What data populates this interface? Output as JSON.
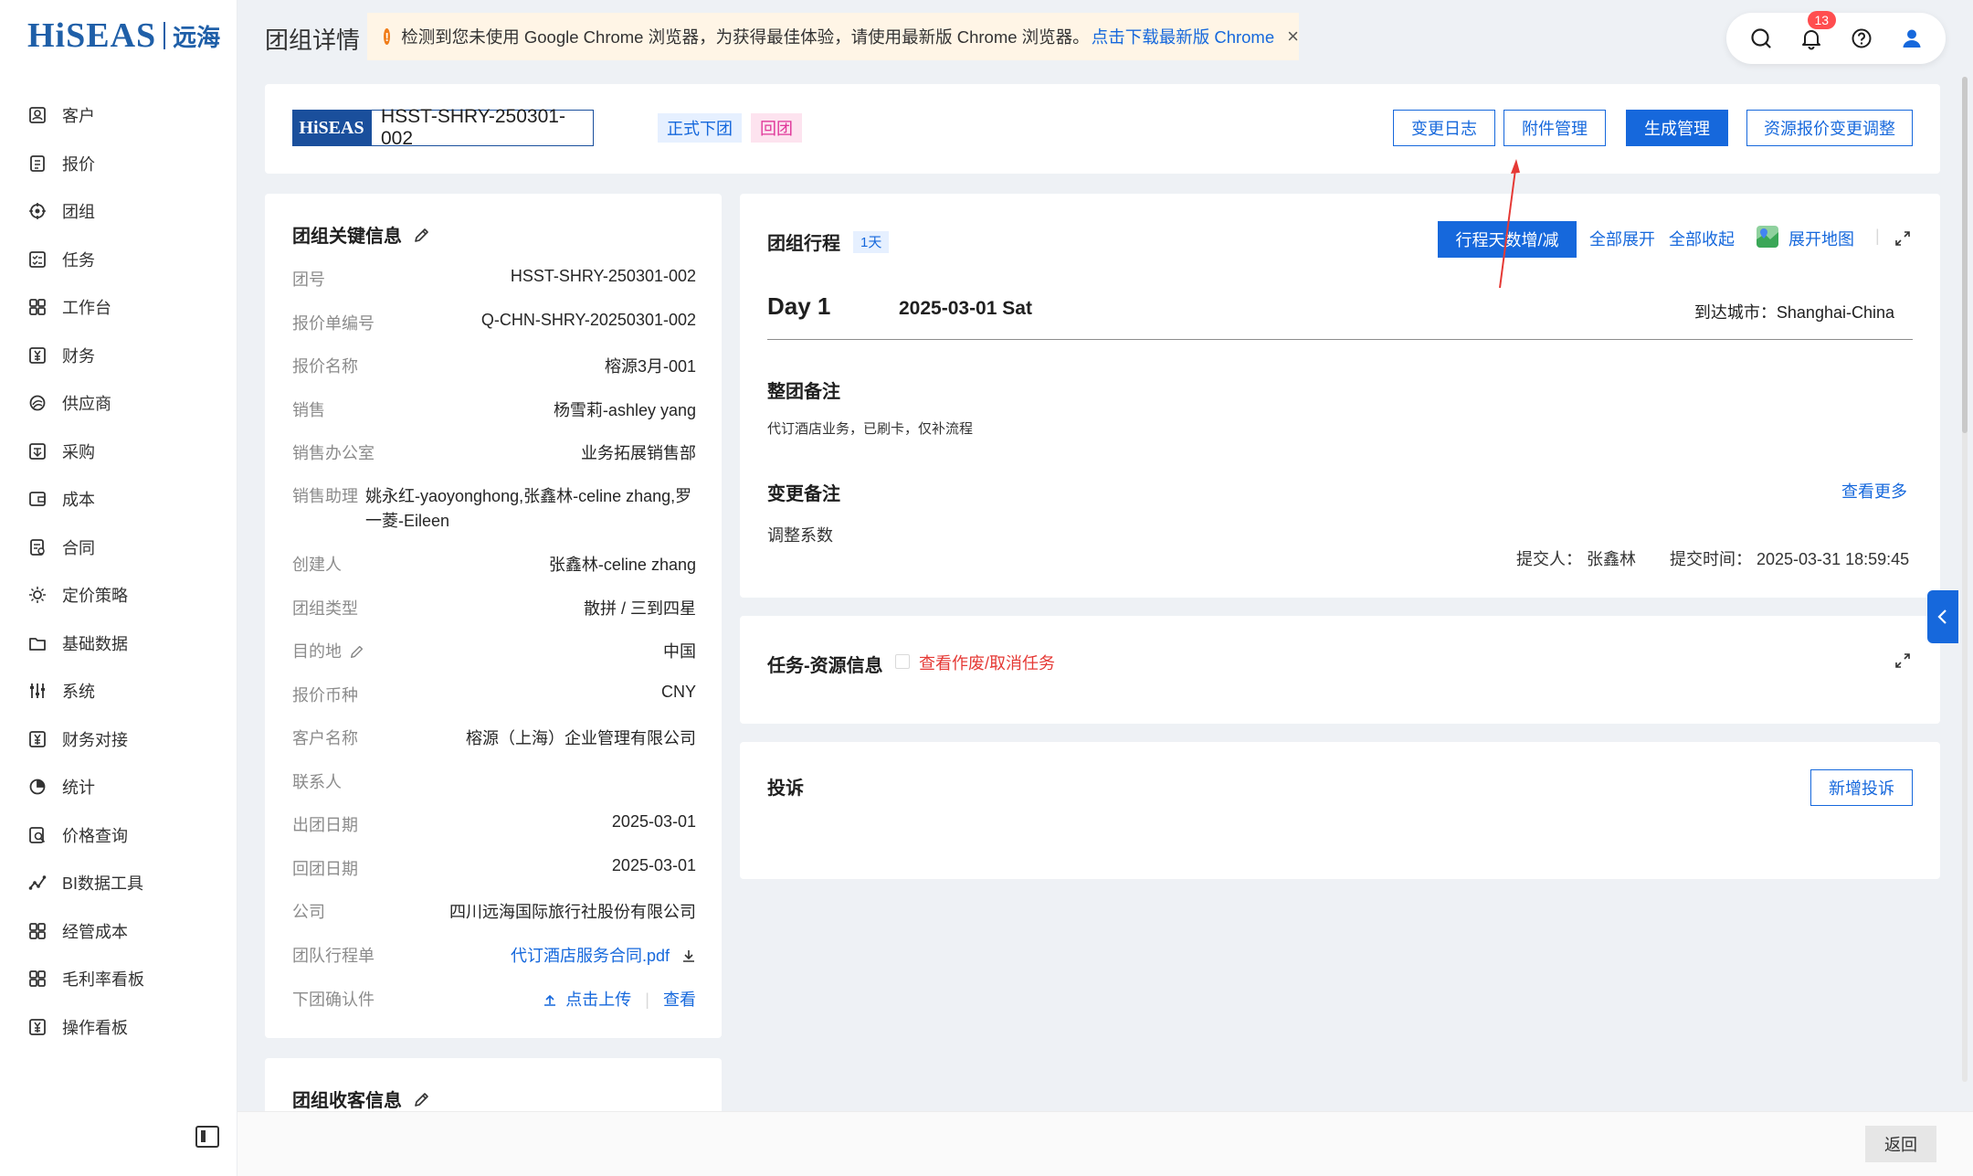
{
  "brand": {
    "name_en": "HiSEAS",
    "name_cn": "远海"
  },
  "sidebar": {
    "items": [
      {
        "label": "客户",
        "icon": "customer-icon"
      },
      {
        "label": "报价",
        "icon": "quote-icon"
      },
      {
        "label": "团组",
        "icon": "group-icon"
      },
      {
        "label": "任务",
        "icon": "task-icon"
      },
      {
        "label": "工作台",
        "icon": "workbench-icon"
      },
      {
        "label": "财务",
        "icon": "finance-icon"
      },
      {
        "label": "供应商",
        "icon": "supplier-icon"
      },
      {
        "label": "采购",
        "icon": "purchase-icon"
      },
      {
        "label": "成本",
        "icon": "cost-icon"
      },
      {
        "label": "合同",
        "icon": "contract-icon"
      },
      {
        "label": "定价策略",
        "icon": "pricing-icon"
      },
      {
        "label": "基础数据",
        "icon": "base-data-icon"
      },
      {
        "label": "系统",
        "icon": "system-icon"
      },
      {
        "label": "财务对接",
        "icon": "finance-link-icon"
      },
      {
        "label": "统计",
        "icon": "statistics-icon"
      },
      {
        "label": "价格查询",
        "icon": "price-search-icon"
      },
      {
        "label": "BI数据工具",
        "icon": "bi-tool-icon"
      },
      {
        "label": "经管成本",
        "icon": "management-cost-icon"
      },
      {
        "label": "毛利率看板",
        "icon": "margin-board-icon"
      },
      {
        "label": "操作看板",
        "icon": "operation-board-icon"
      }
    ]
  },
  "header": {
    "title": "团组详情",
    "warning_text": "检测到您未使用 Google Chrome 浏览器，为获得最佳体验，请使用最新版 Chrome 浏览器。",
    "warning_link": "点击下载最新版 Chrome",
    "notification_count": "13"
  },
  "top": {
    "logo_text": "HiSEAS",
    "tour_code": "HSST-SHRY-250301-002",
    "tags": [
      "正式下团",
      "回团"
    ],
    "buttons": [
      "变更日志",
      "附件管理",
      "生成管理",
      "资源报价变更调整"
    ]
  },
  "key_info": {
    "title": "团组关键信息",
    "rows": [
      {
        "label": "团号",
        "value": "HSST-SHRY-250301-002"
      },
      {
        "label": "报价单编号",
        "value": "Q-CHN-SHRY-20250301-002"
      },
      {
        "label": "报价名称",
        "value": "榕源3月-001"
      },
      {
        "label": "销售",
        "value": "杨雪莉-ashley yang"
      },
      {
        "label": "销售办公室",
        "value": "业务拓展销售部"
      },
      {
        "label": "销售助理",
        "value": "姚永红-yaoyonghong,张鑫林-celine zhang,罗一菱-Eileen"
      },
      {
        "label": "创建人",
        "value": "张鑫林-celine zhang"
      },
      {
        "label": "团组类型",
        "value": "散拼 / 三到四星"
      },
      {
        "label": "目的地",
        "value": "中国"
      },
      {
        "label": "报价币种",
        "value": "CNY"
      },
      {
        "label": "客户名称",
        "value": "榕源（上海）企业管理有限公司"
      },
      {
        "label": "联系人",
        "value": ""
      },
      {
        "label": "出团日期",
        "value": "2025-03-01"
      },
      {
        "label": "回团日期",
        "value": "2025-03-01"
      },
      {
        "label": "公司",
        "value": "四川远海国际旅行社股份有限公司"
      },
      {
        "label": "团队行程单",
        "value": "代订酒店服务合同.pdf"
      },
      {
        "label": "下团确认件",
        "upload": "点击上传",
        "view": "查看"
      }
    ]
  },
  "receiver_info": {
    "title": "团组收客信息"
  },
  "itinerary": {
    "title": "团组行程",
    "days_tag": "1天",
    "adjust_button": "行程天数增/减",
    "expand_all": "全部展开",
    "collapse_all": "全部收起",
    "map_link": "展开地图",
    "day_label": "Day 1",
    "day_date": "2025-03-01 Sat",
    "arrival_city": "到达城市：Shanghai-China",
    "group_note_title": "整团备注",
    "group_note": "代订酒店业务，已刷卡，仅补流程",
    "change_note_title": "变更备注",
    "view_more": "查看更多",
    "change_note": "调整系数",
    "submitter": "提交人：  张鑫林",
    "submit_time": "提交时间：  2025-03-31 18:59:45"
  },
  "task_section": {
    "title": "任务-资源信息",
    "link": "查看作废/取消任务"
  },
  "complaint_section": {
    "title": "投诉",
    "add_button": "新增投诉"
  },
  "footer": {
    "back_button": "返回"
  },
  "colors": {
    "primary": "#1668dc",
    "brand_blue": "#1a4f9c",
    "warning_bg": "#fff5e6",
    "danger": "#e53935"
  }
}
